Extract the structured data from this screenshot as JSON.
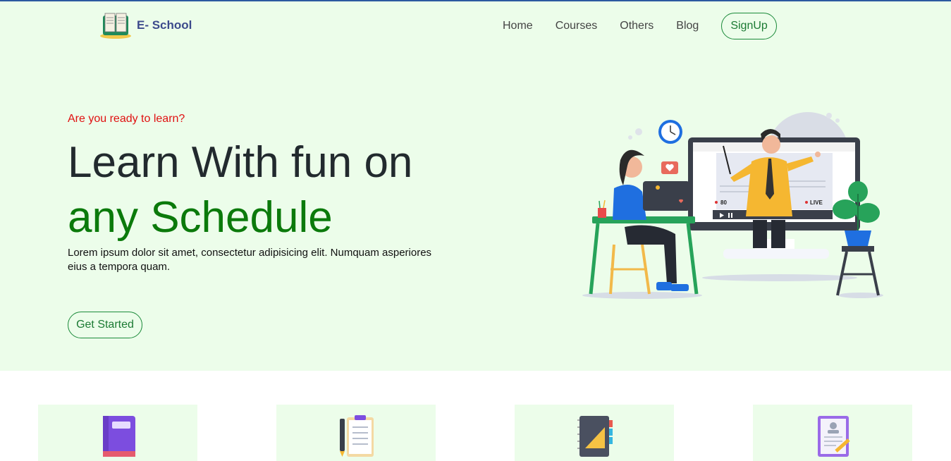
{
  "brand": {
    "name": "E- School"
  },
  "nav": {
    "home": "Home",
    "courses": "Courses",
    "others": "Others",
    "blog": "Blog",
    "signup": "SignUp"
  },
  "hero": {
    "kicker": "Are you ready to learn?",
    "title_line1": "Learn With fun on",
    "title_line2": "any Schedule",
    "lead": "Lorem ipsum dolor sit amet, consectetur adipisicing elit. Numquam asperiores eius a tempora quam.",
    "cta": "Get Started"
  },
  "illustration": {
    "viewer_count": "80",
    "live_label": "LIVE"
  },
  "features": [
    {
      "icon": "book-icon"
    },
    {
      "icon": "clipboard-pen-icon"
    },
    {
      "icon": "notebook-ruler-icon"
    },
    {
      "icon": "certificate-icon"
    }
  ],
  "colors": {
    "accent": "#1b8a3a",
    "kicker": "#e01010",
    "hero_bg": "#ecfdea",
    "brand": "#3c4a8c"
  }
}
